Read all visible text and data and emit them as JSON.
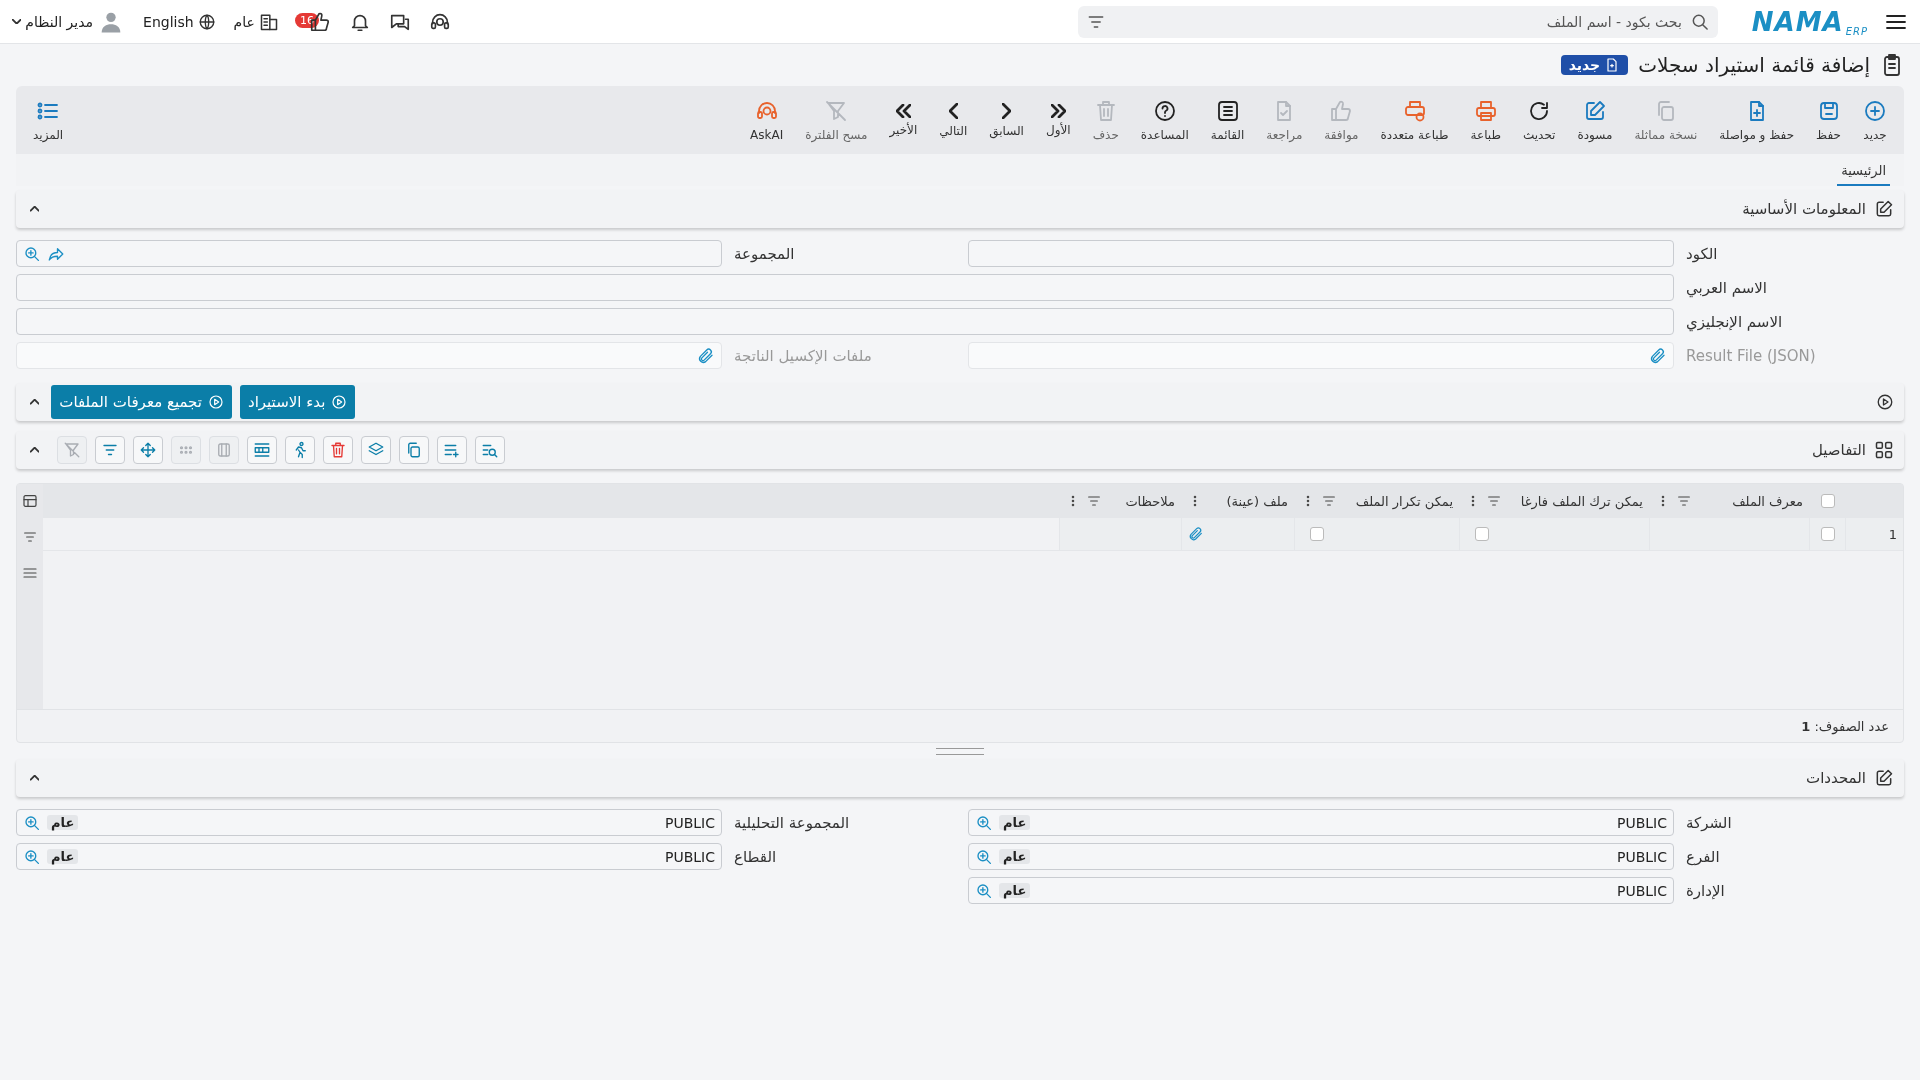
{
  "topbar": {
    "logo": "NAMA",
    "logo_sub": "ERP",
    "search": {
      "placeholder": "بحث بكود - اسم الملف"
    },
    "user": "مدير النظام",
    "language": "English",
    "scope": "عام",
    "likes_count": "16"
  },
  "page": {
    "title": "إضافة قائمة استيراد سجلات",
    "badge": "جديد"
  },
  "toolbar": [
    {
      "label": "جديد",
      "color": "#1b7bbf",
      "disabled": false
    },
    {
      "label": "حفظ",
      "color": "#1b7bbf",
      "disabled": false
    },
    {
      "label": "حفظ و مواصلة",
      "color": "#1b7bbf",
      "disabled": false
    },
    {
      "label": "نسخة مماثلة",
      "color": "#b4b8be",
      "disabled": true
    },
    {
      "label": "مسودة",
      "color": "#1b7bbf",
      "disabled": false
    },
    {
      "label": "تحديث",
      "color": "#222222",
      "disabled": false
    },
    {
      "label": "طباعة",
      "color": "#e8622c",
      "disabled": false
    },
    {
      "label": "طباعة متعددة",
      "color": "#e8622c",
      "disabled": false
    },
    {
      "label": "موافقة",
      "color": "#b4b8be",
      "disabled": true
    },
    {
      "label": "مراجعة",
      "color": "#b4b8be",
      "disabled": true
    },
    {
      "label": "القائمة",
      "color": "#222222",
      "disabled": false
    },
    {
      "label": "المساعدة",
      "color": "#222222",
      "disabled": false
    },
    {
      "label": "حذف",
      "color": "#b4b8be",
      "disabled": true
    },
    {
      "label": "الأول",
      "color": "#222222",
      "disabled": false
    },
    {
      "label": "السابق",
      "color": "#222222",
      "disabled": false
    },
    {
      "label": "التالي",
      "color": "#222222",
      "disabled": false
    },
    {
      "label": "الأخير",
      "color": "#222222",
      "disabled": false
    },
    {
      "label": "مسح الفلترة",
      "color": "#b4b8be",
      "disabled": true
    },
    {
      "label": "AskAI",
      "color": "#e8622c",
      "disabled": false
    }
  ],
  "more": {
    "label": "المزيد"
  },
  "tabs": [
    {
      "label": "الرئيسية",
      "selected": true
    }
  ],
  "basic_info": {
    "title": "المعلومات الأساسية",
    "expanded": true,
    "fields": [
      {
        "label": "الكود",
        "kind": "text",
        "disabled": false
      },
      {
        "label": "المجموعة",
        "kind": "lookup",
        "disabled": false
      },
      {
        "label": "الاسم العربي",
        "kind": "wide",
        "disabled": false
      },
      {
        "label": "الاسم الإنجليزي",
        "kind": "wide",
        "disabled": false
      },
      {
        "label": "Result File (JSON)",
        "kind": "file",
        "disabled": true
      },
      {
        "label": "ملفات الإكسيل الناتجة",
        "kind": "file",
        "disabled": true
      }
    ]
  },
  "actions": {
    "expanded": true,
    "buttons": [
      "بدء الاستيراد",
      "تجميع معرفات الملفات"
    ]
  },
  "details": {
    "title": "التفاصيل",
    "expanded": true,
    "tools": [
      {
        "disabled": false
      },
      {
        "disabled": false
      },
      {
        "disabled": false
      },
      {
        "disabled": false
      },
      {
        "disabled": false
      },
      {
        "disabled": false
      },
      {
        "disabled": false
      },
      {
        "disabled": true
      },
      {
        "disabled": true
      },
      {
        "disabled": false
      },
      {
        "disabled": false
      },
      {
        "disabled": true
      }
    ],
    "columns": [
      {
        "label": "معرف الملف",
        "filterable": true
      },
      {
        "label": "يمكن ترك الملف فارغا",
        "filterable": true
      },
      {
        "label": "يمكن تكرار الملف",
        "filterable": true
      },
      {
        "label": "ملف (عينة)",
        "filterable": false
      },
      {
        "label": "ملاحظات",
        "filterable": true
      }
    ],
    "all_selected": false,
    "rows": [
      {
        "number": "1",
        "selected": false,
        "cells": [
          {
            "kind": "empty"
          },
          {
            "kind": "checkbox",
            "checked": false
          },
          {
            "kind": "checkbox",
            "checked": false
          },
          {
            "kind": "attachment"
          },
          {
            "kind": "empty"
          }
        ]
      }
    ],
    "footer": "عدد الصفوف: **1**"
  },
  "restrictions": {
    "title": "المحددات",
    "expanded": true,
    "fields": [
      {
        "label": "الشركة",
        "value": "PUBLIC",
        "chip": "عام"
      },
      {
        "label": "المجموعة التحليلية",
        "value": "PUBLIC",
        "chip": "عام"
      },
      {
        "label": "الفرع",
        "value": "PUBLIC",
        "chip": "عام"
      },
      {
        "label": "القطاع",
        "value": "PUBLIC",
        "chip": "عام"
      },
      {
        "label": "الإدارة",
        "value": "PUBLIC",
        "chip": "عام"
      }
    ]
  }
}
